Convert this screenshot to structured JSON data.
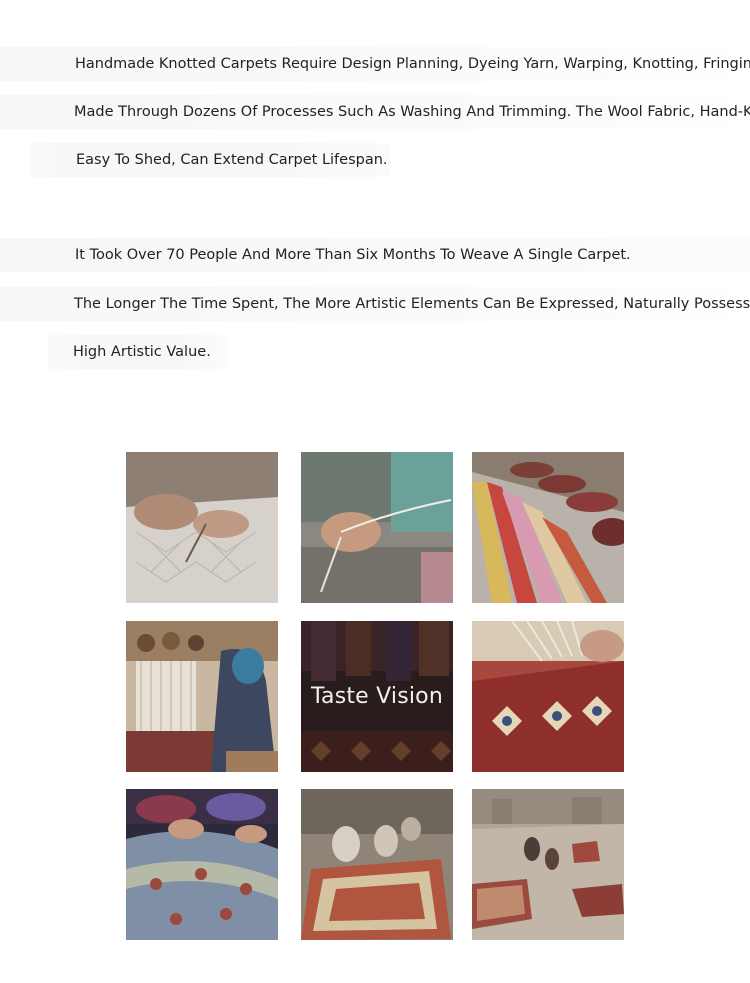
{
  "paragraph_1": {
    "lines": [
      "Handmade Knotted Carpets Require Design Planning, Dyeing Yarn, Warping, Knotting, Fringing,",
      "Made Through Dozens Of Processes Such As Washing And Trimming. The Wool Fabric, Hand-Knotted",
      "Easy To Shed, Can Extend Carpet Lifespan."
    ]
  },
  "paragraph_2": {
    "lines": [
      "It Took Over 70 People And More Than Six Months To Weave A Single Carpet.",
      "The Longer The Time Spent, The More Artistic Elements Can Be Expressed, Naturally Possessing",
      "High Artistic Value."
    ]
  },
  "gallery": {
    "center_label": "Taste Vision",
    "tiles": [
      {
        "icon": "hands-drawing-pattern-photo"
      },
      {
        "icon": "hand-knotting-thread-photo"
      },
      {
        "icon": "dyed-yarn-skeins-photo"
      },
      {
        "icon": "woman-weaving-at-loom-photo"
      },
      {
        "icon": "taste-vision-rug-photo"
      },
      {
        "icon": "hands-knotting-rug-fringe-photo"
      },
      {
        "icon": "rolled-carpets-photo"
      },
      {
        "icon": "workers-washing-carpet-photo"
      },
      {
        "icon": "carpets-drying-outdoors-photo"
      }
    ]
  }
}
